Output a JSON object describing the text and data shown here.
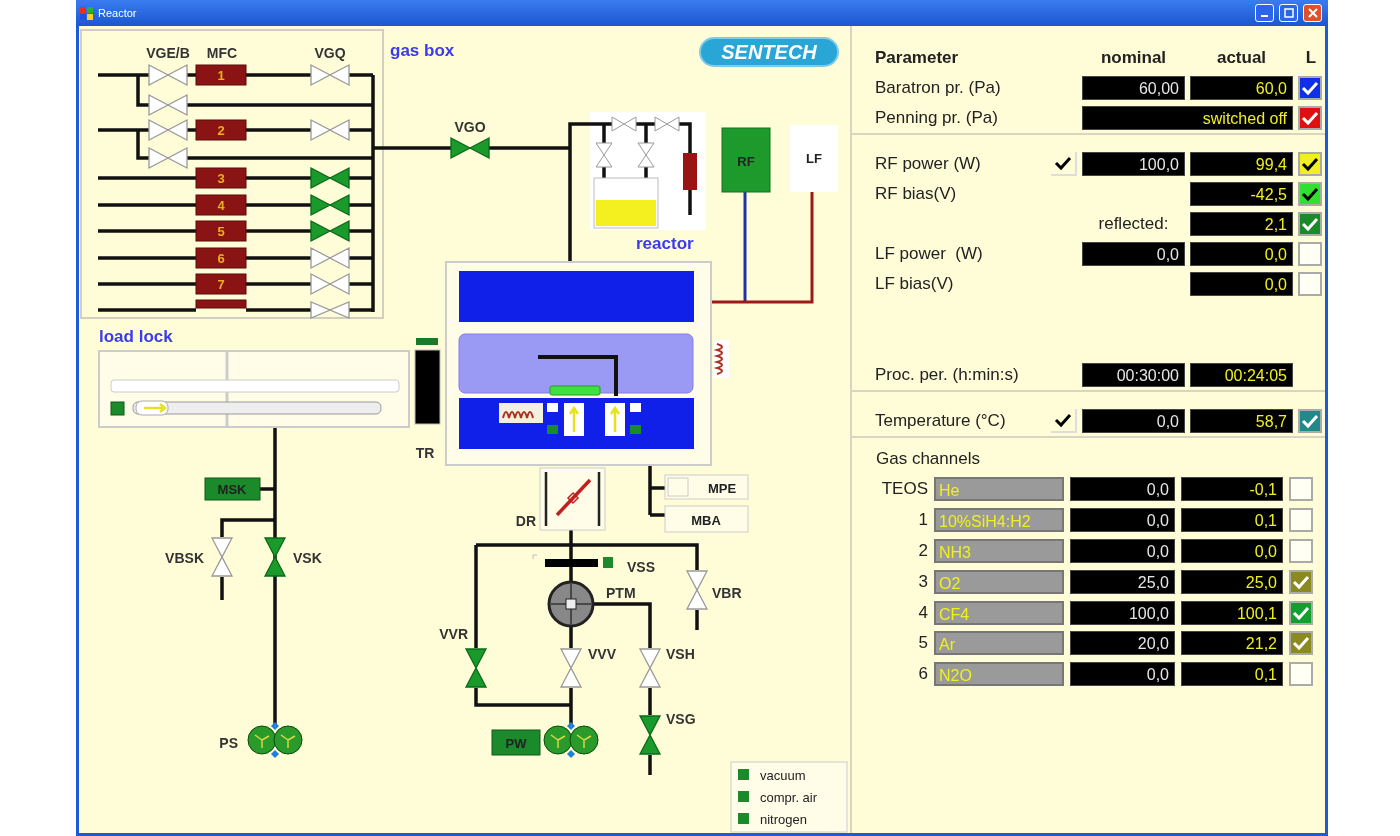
{
  "window": {
    "title": "Reactor"
  },
  "diagram": {
    "logo": "SENTECH",
    "gas_box": {
      "title": "gas box",
      "headers": [
        "VGE/B",
        "MFC",
        "VGQ"
      ],
      "mfcs": [
        {
          "label": "1",
          "valve_open": false
        },
        {
          "label": "2",
          "valve_open": false
        },
        {
          "label": "3",
          "valve_open": true
        },
        {
          "label": "4",
          "valve_open": true
        },
        {
          "label": "5",
          "valve_open": true
        },
        {
          "label": "6",
          "valve_open": false
        },
        {
          "label": "7",
          "valve_open": false
        },
        {
          "valve_open": false
        }
      ]
    },
    "reactor_title": "reactor",
    "load_lock_title": "load lock",
    "labels": {
      "rf": "RF",
      "lf": "LF",
      "tr": "TR",
      "msk": "MSK",
      "dr": "DR",
      "mpe": "MPE",
      "mba": "MBA",
      "vss": "VSS",
      "ptm": "PTM",
      "ps": "PS",
      "pw": "PW"
    },
    "valves": [
      {
        "label": "VGO",
        "open": true
      },
      {
        "label": "VBSK",
        "open": false
      },
      {
        "label": "VSK",
        "open": true
      },
      {
        "label": "VVR",
        "open": true
      },
      {
        "label": "VVV",
        "open": false
      },
      {
        "label": "VSH",
        "open": false
      },
      {
        "label": "VBR",
        "open": false
      },
      {
        "label": "VSG",
        "open": true
      }
    ],
    "legend": [
      "vacuum",
      "compr. air",
      "nitrogen"
    ]
  },
  "parameters": {
    "header": {
      "parameter": "Parameter",
      "nominal": "nominal",
      "actual": "actual",
      "limit": "L"
    },
    "sections": [
      {
        "rows": [
          {
            "kind": "value",
            "label": "Baratron pr. (Pa)",
            "nominal": "60,00",
            "actual": "60,0",
            "limit": {
              "checked": true,
              "color": "#1030e8"
            }
          },
          {
            "kind": "wide",
            "label": "Penning pr. (Pa)",
            "actual": "switched off",
            "limit": {
              "checked": true,
              "color": "#e01010"
            }
          }
        ]
      },
      {
        "rows": [
          {
            "kind": "value",
            "label": "RF power (W)",
            "enabled": true,
            "nominal": "100,0",
            "actual": "99,4",
            "limit": {
              "checked": true,
              "color": "#f0f020"
            }
          },
          {
            "kind": "value",
            "label": "RF bias(V)",
            "actual": "-42,5",
            "limit": {
              "checked": true,
              "color": "#30e030"
            }
          },
          {
            "kind": "sub",
            "label": "reflected:",
            "actual": "2,1",
            "limit": {
              "checked": true,
              "color": "#1a8a2a"
            }
          },
          {
            "kind": "value",
            "label": "LF power  (W)",
            "nominal": "0,0",
            "actual": "0,0",
            "limit": {
              "checked": false
            }
          },
          {
            "kind": "value",
            "label": "LF bias(V)",
            "actual": "0,0",
            "limit": {
              "checked": false
            }
          },
          {
            "kind": "time",
            "label": "Proc. per. (h:min:s)",
            "nominal": "00:30:00",
            "actual": "00:24:05"
          }
        ]
      },
      {
        "rows": [
          {
            "kind": "value",
            "label": "Temperature (°C)",
            "enabled": true,
            "nominal": "0,0",
            "actual": "58,7",
            "limit": {
              "checked": true,
              "color": "#208a8a"
            }
          }
        ]
      }
    ]
  },
  "gas_channels": {
    "title": "Gas channels",
    "rows": [
      {
        "index": "TEOS",
        "gas": "He",
        "nominal": "0,0",
        "actual": "-0,1",
        "checked": false
      },
      {
        "index": "1",
        "gas": "10%SiH4:H2",
        "nominal": "0,0",
        "actual": "0,1",
        "checked": false
      },
      {
        "index": "2",
        "gas": "NH3",
        "nominal": "0,0",
        "actual": "0,0",
        "checked": false
      },
      {
        "index": "3",
        "gas": "O2",
        "nominal": "25,0",
        "actual": "25,0",
        "checked": true,
        "color": "#8a8a20"
      },
      {
        "index": "4",
        "gas": "CF4",
        "nominal": "100,0",
        "actual": "100,1",
        "checked": true,
        "color": "#10a030"
      },
      {
        "index": "5",
        "gas": "Ar",
        "nominal": "20,0",
        "actual": "21,2",
        "checked": true,
        "color": "#8a8a20"
      },
      {
        "index": "6",
        "gas": "N2O",
        "nominal": "0,0",
        "actual": "0,1",
        "checked": false
      }
    ]
  }
}
